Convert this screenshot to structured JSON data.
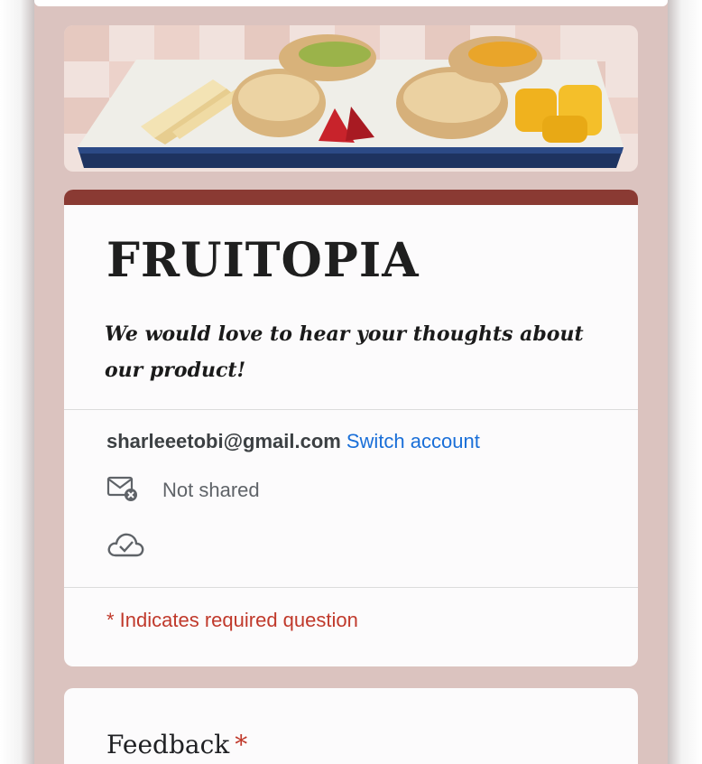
{
  "header": {
    "image_alt": "Plate of biscuits with apple slices, strawberries, jam and orange pieces"
  },
  "form": {
    "title": "FRUITOPIA",
    "description": "We would love to hear your thoughts about our product!",
    "accent_color": "#8a3a33",
    "background_color": "#dbc3bf",
    "account": {
      "email": "sharleeetobi@gmail.com",
      "switch_label": "Switch account"
    },
    "email_status": {
      "icon": "mail-blocked-icon",
      "text": "Not shared"
    },
    "draft_status": {
      "icon": "cloud-check-icon"
    },
    "required_note": "* Indicates required question"
  },
  "questions": [
    {
      "title": "Feedback",
      "required_mark": "*"
    }
  ]
}
